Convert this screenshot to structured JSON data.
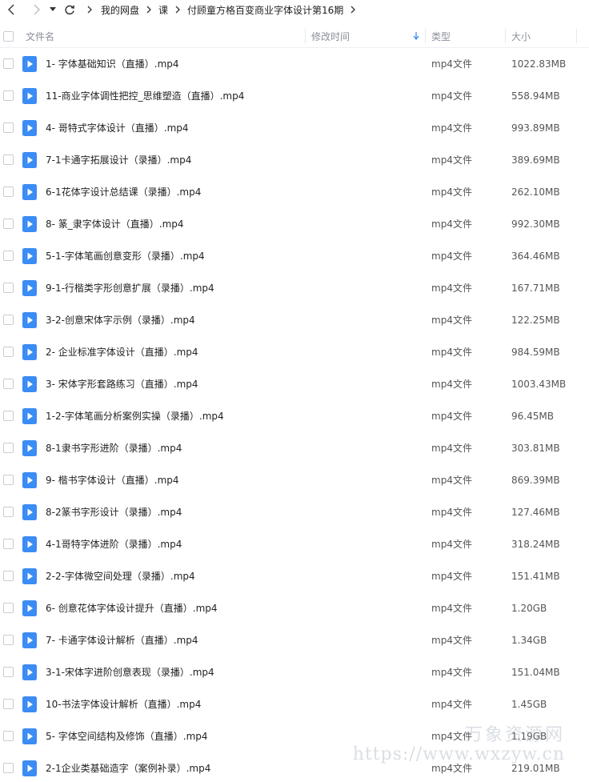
{
  "toolbar": {
    "back_icon": "chevron-left-icon",
    "forward_icon": "chevron-right-icon",
    "history_icon": "caret-down-icon",
    "refresh_icon": "refresh-icon"
  },
  "breadcrumb": [
    "我的网盘",
    "课",
    "付顾童方格百变商业字体设计第16期"
  ],
  "columns": {
    "name": "文件名",
    "modified": "修改时间",
    "type": "类型",
    "size": "大小"
  },
  "files": [
    {
      "name": "1- 字体基础知识（直播）.mp4",
      "type": "mp4文件",
      "size": "1022.83MB"
    },
    {
      "name": "11-商业字体调性把控_思维塑造（直播）.mp4",
      "type": "mp4文件",
      "size": "558.94MB"
    },
    {
      "name": "4- 哥特式字体设计（直播）.mp4",
      "type": "mp4文件",
      "size": "993.89MB"
    },
    {
      "name": "7-1卡通字拓展设计（录播）.mp4",
      "type": "mp4文件",
      "size": "389.69MB"
    },
    {
      "name": "6-1花体字设计总结课（录播）.mp4",
      "type": "mp4文件",
      "size": "262.10MB"
    },
    {
      "name": "8- 篆_隶字体设计（直播）.mp4",
      "type": "mp4文件",
      "size": "992.30MB"
    },
    {
      "name": "5-1-字体笔画创意变形（录播）.mp4",
      "type": "mp4文件",
      "size": "364.46MB"
    },
    {
      "name": "9-1-行楷类字形创意扩展（录播）.mp4",
      "type": "mp4文件",
      "size": "167.71MB"
    },
    {
      "name": "3-2-创意宋体字示例（录播）.mp4",
      "type": "mp4文件",
      "size": "122.25MB"
    },
    {
      "name": "2- 企业标准字体设计（直播）.mp4",
      "type": "mp4文件",
      "size": "984.59MB"
    },
    {
      "name": "3- 宋体字形套路练习（直播）.mp4",
      "type": "mp4文件",
      "size": "1003.43MB"
    },
    {
      "name": "1-2-字体笔画分析案例实操（录播）.mp4",
      "type": "mp4文件",
      "size": "96.45MB"
    },
    {
      "name": "8-1隶书字形进阶（录播）.mp4",
      "type": "mp4文件",
      "size": "303.81MB"
    },
    {
      "name": "9- 楷书字体设计（直播）.mp4",
      "type": "mp4文件",
      "size": "869.39MB"
    },
    {
      "name": "8-2篆书字形设计（录播）.mp4",
      "type": "mp4文件",
      "size": "127.46MB"
    },
    {
      "name": "4-1哥特字体进阶（录播）.mp4",
      "type": "mp4文件",
      "size": "318.24MB"
    },
    {
      "name": "2-2-字体微空间处理（录播）.mp4",
      "type": "mp4文件",
      "size": "151.41MB"
    },
    {
      "name": "6- 创意花体字体设计提升（直播）.mp4",
      "type": "mp4文件",
      "size": "1.20GB"
    },
    {
      "name": "7- 卡通字体设计解析（直播）.mp4",
      "type": "mp4文件",
      "size": "1.34GB"
    },
    {
      "name": "3-1-宋体字进阶创意表现（录播）.mp4",
      "type": "mp4文件",
      "size": "151.04MB"
    },
    {
      "name": "10-书法字体设计解析（直播）.mp4",
      "type": "mp4文件",
      "size": "1.45GB"
    },
    {
      "name": "5- 字体空间结构及修饰（直播）.mp4",
      "type": "mp4文件",
      "size": "1.19GB"
    },
    {
      "name": "2-1企业类基础造字（案例补录）.mp4",
      "type": "mp4文件",
      "size": "219.01MB"
    }
  ],
  "file_icon": "video-file-icon",
  "watermark": {
    "title": "万象资源网",
    "url": "https://www.wxzyw.cn"
  },
  "colors": {
    "accent": "#3b8cf5",
    "sort_arrow": "#3b8cf5",
    "header_text": "#8a8f99"
  }
}
